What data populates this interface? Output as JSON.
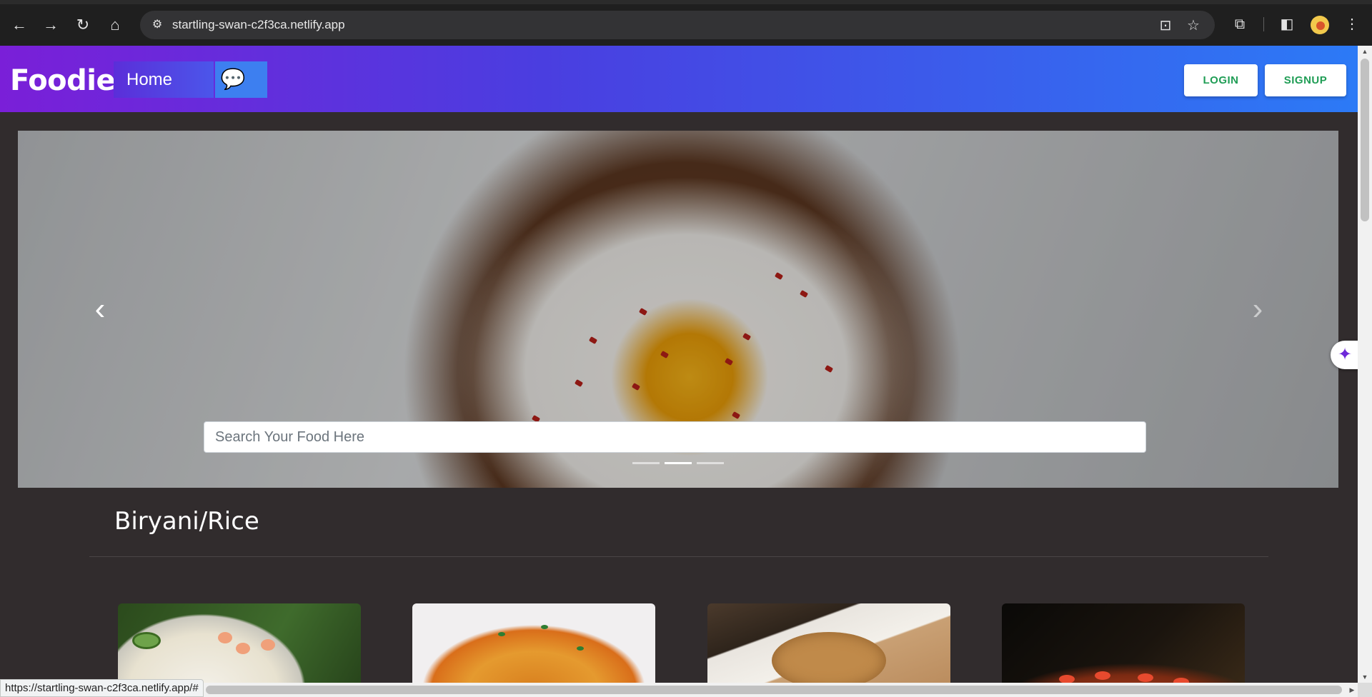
{
  "browser": {
    "url": "startling-swan-c2f3ca.netlify.app",
    "status_url": "https://startling-swan-c2f3ca.netlify.app/#",
    "icons": [
      "back-icon",
      "forward-icon",
      "reload-icon",
      "home-icon",
      "site-info-icon",
      "install-app-icon",
      "bookmark-star-icon",
      "extensions-icon",
      "side-panel-icon",
      "profile-avatar",
      "more-menu-icon",
      "gemini-sparkle-icon"
    ]
  },
  "navbar": {
    "brand": "Foodie",
    "home_label": "Home",
    "chat_icon": "chat-bubbles-icon",
    "login_label": "LOGIN",
    "signup_label": "SIGNUP",
    "gradient": [
      "#7a1fd8",
      "#2c7af6"
    ],
    "button_text_color": "#1f9d55"
  },
  "carousel": {
    "search_placeholder": "Search Your Food Here",
    "slide_count": 3,
    "active_slide": 2
  },
  "section": {
    "title": "Biryani/Rice",
    "cards": [
      {
        "image": "shrimp-fried-rice"
      },
      {
        "image": "chicken-biryani"
      },
      {
        "image": "fried-rice-plate"
      },
      {
        "image": "tomato-rice-pan"
      }
    ]
  }
}
